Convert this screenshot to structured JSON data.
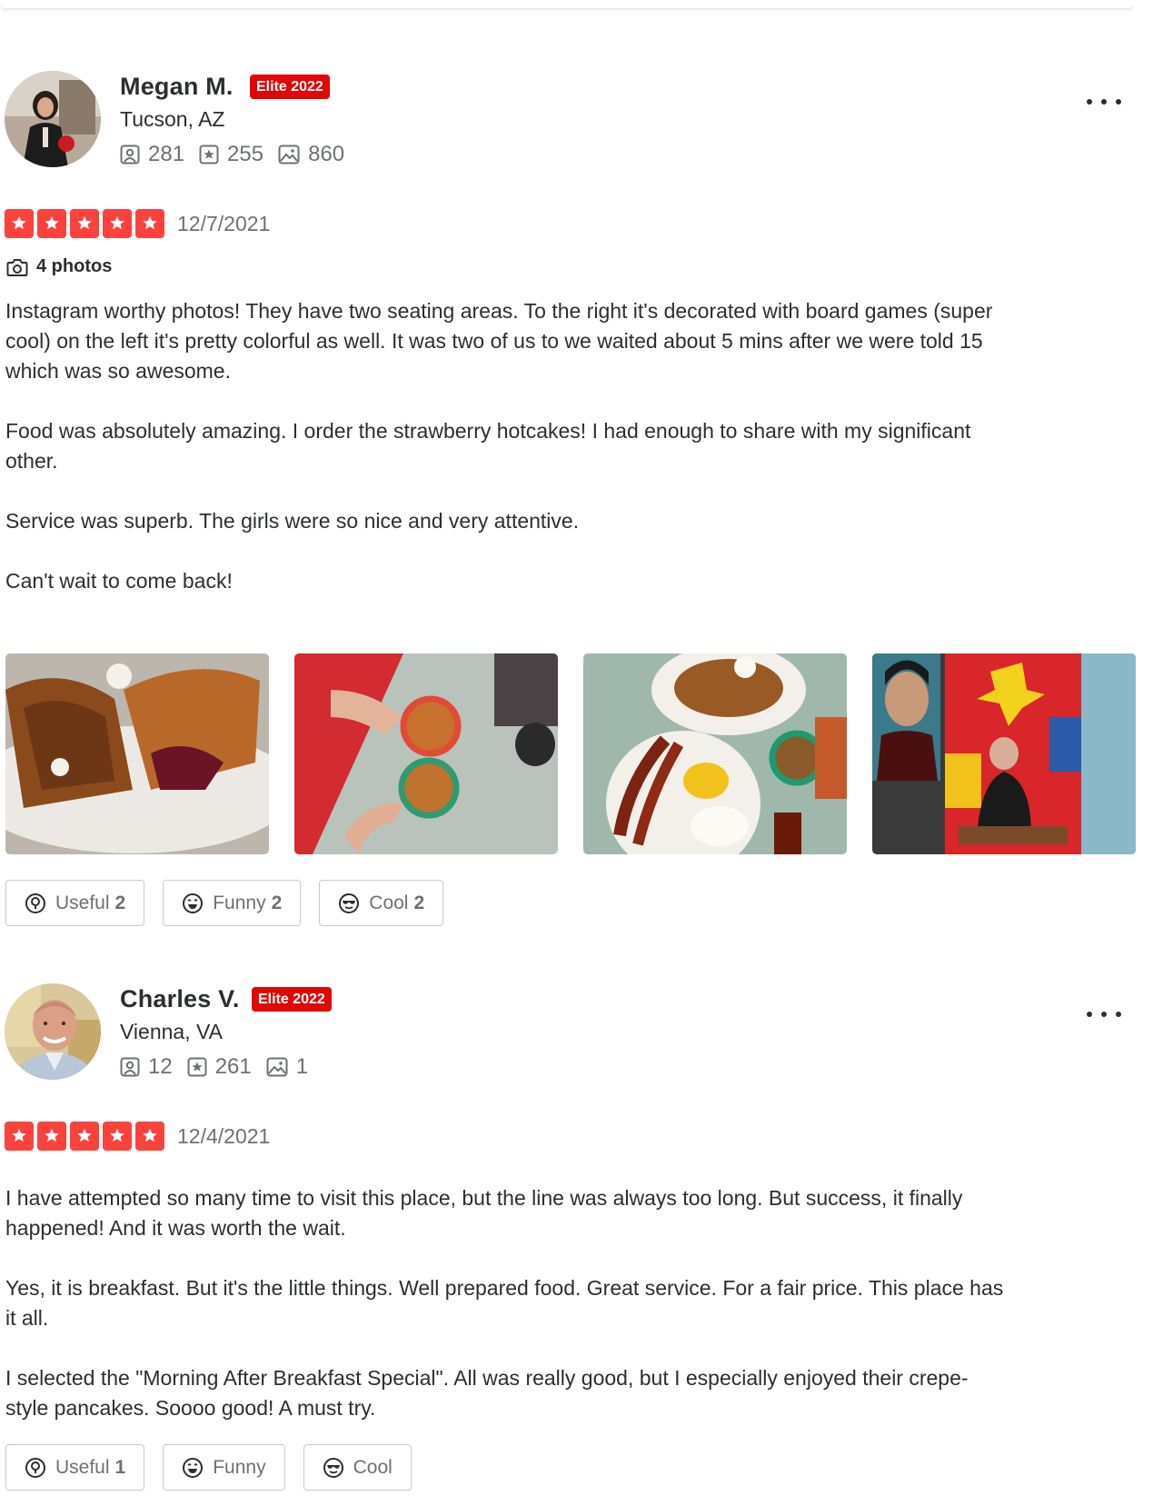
{
  "reviews": [
    {
      "user": {
        "name": "Megan M.",
        "elite_badge": "Elite 2022",
        "location": "Tucson, AZ",
        "friends": "281",
        "reviews": "255",
        "photos": "860",
        "avatar": "avatar-photo"
      },
      "rating": 5,
      "date": "12/7/2021",
      "photos_label": "4 photos",
      "paragraphs": [
        "Instagram worthy photos! They have two seating areas. To the right it's decorated with board games (super cool) on the left it's pretty colorful as well. It was two of us to we waited about 5 mins after we were told 15 which was so awesome.",
        "Food was absolutely amazing. I order the strawberry hotcakes! I had enough to share with my significant other.",
        "Service was superb. The girls were so nice and very attentive.",
        "Can't wait to come back!"
      ],
      "reactions": {
        "useful_label": "Useful",
        "useful_count": "2",
        "funny_label": "Funny",
        "funny_count": "2",
        "cool_label": "Cool",
        "cool_count": "2"
      }
    },
    {
      "user": {
        "name": "Charles V.",
        "elite_badge": "Elite 2022",
        "location": "Vienna, VA",
        "friends": "12",
        "reviews": "261",
        "photos": "1",
        "avatar": "avatar-photo"
      },
      "rating": 5,
      "date": "12/4/2021",
      "paragraphs": [
        "I have attempted so many time to visit this place, but the line was always too long.  But success, it finally happened!  And it was worth the wait.",
        "Yes, it is breakfast.  But it's the little things.  Well prepared food.  Great service.  For a fair price.  This place has it all.",
        "I selected the \"Morning After Breakfast Special\".  All was really good, but I especially enjoyed their crepe-style pancakes.  Soooo good!  A must try."
      ],
      "reactions": {
        "useful_label": "Useful",
        "useful_count": "1",
        "funny_label": "Funny",
        "funny_count": "",
        "cool_label": "Cool",
        "cool_count": ""
      }
    }
  ],
  "colors": {
    "star": "#fb433c",
    "elite": "#e00707",
    "text": "#2d2e2f",
    "muted": "#6e7072",
    "border": "#c8c9ca"
  }
}
